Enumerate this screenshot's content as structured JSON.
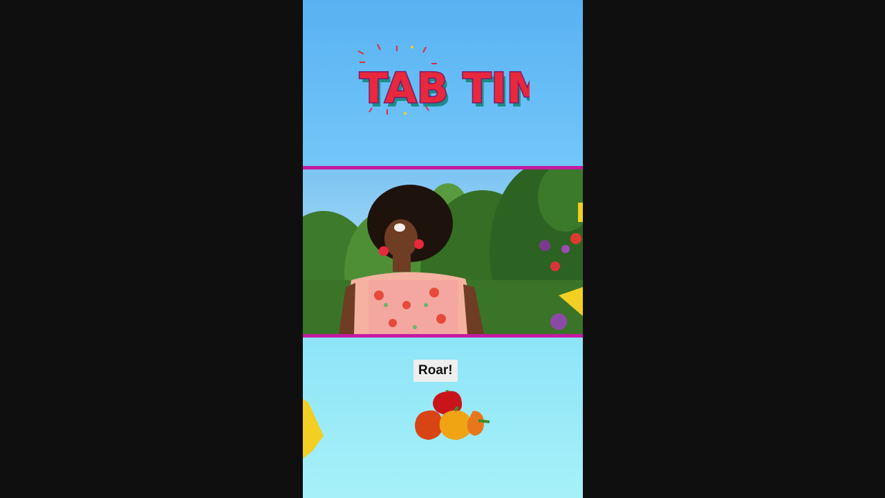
{
  "video": {
    "logo_text": "TAB TIME",
    "caption": "Roar!"
  },
  "colors": {
    "background": "#0f0f0f",
    "border_accent": "#c41aa0",
    "logo_red": "#e8283c",
    "logo_purple": "#7a1a6e",
    "logo_yellow": "#f4d21a",
    "logo_teal": "#1e8c8a",
    "sky_top": "#58b2f2",
    "sky_bottom": "#a6f1f9"
  },
  "icons": {
    "logo": "tab-time-logo",
    "scene": "singer-in-garden",
    "food": "bell-peppers",
    "decoration": "yellow-paper-shape"
  }
}
